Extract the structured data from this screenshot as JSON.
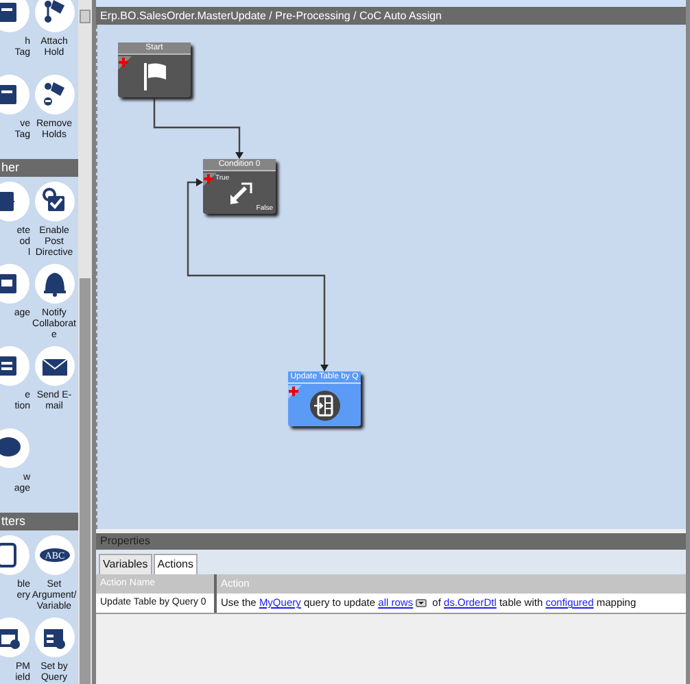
{
  "toolbox": {
    "sections": [
      {
        "items": [
          {
            "label": "h\nTag"
          },
          {
            "label": "Attach Hold"
          },
          {
            "label": "ve\nTag"
          },
          {
            "label": "Remove Holds"
          }
        ]
      },
      {
        "header": "her",
        "items": [
          {
            "label": "ete\nod\nl"
          },
          {
            "label": "Enable Post Directive"
          },
          {
            "label": "age"
          },
          {
            "label": "Notify\nCollaborat\ne"
          },
          {
            "label": "e\ntion"
          },
          {
            "label": "Send E-\nmail"
          },
          {
            "label": "w\nage"
          }
        ]
      },
      {
        "header": "tters",
        "icon_text": "ABC",
        "items": [
          {
            "label": "ble\nery"
          },
          {
            "label": "Set Argument/ Variable"
          },
          {
            "label": "PM\nield"
          },
          {
            "label": "Set by Query"
          }
        ]
      }
    ]
  },
  "workflow": {
    "title": "Erp.BO.SalesOrder.MasterUpdate / Pre-Processing / CoC Auto Assign",
    "nodes": [
      {
        "title": "Start",
        "kind": "start"
      },
      {
        "title": "Condition 0",
        "kind": "condition",
        "true_label": "True",
        "false_label": "False"
      },
      {
        "title": "Update Table by Q",
        "kind": "action"
      }
    ]
  },
  "properties": {
    "title": "Properties",
    "tabs": [
      {
        "label": "Variables",
        "selected": false
      },
      {
        "label": "Actions",
        "selected": true
      }
    ],
    "table": {
      "columns": [
        "Action Name",
        "Action"
      ],
      "rows": [
        {
          "name": "Update Table by Query 0",
          "action": [
            {
              "text": "Use the "
            },
            {
              "text": "MyQuery",
              "kind": "link"
            },
            {
              "text": " query to update "
            },
            {
              "text": "all rows",
              "kind": "link",
              "dropdown": true
            },
            {
              "text": " of "
            },
            {
              "text": "ds.OrderDtl",
              "kind": "link"
            },
            {
              "text": " table with "
            },
            {
              "text": "configured",
              "kind": "link"
            },
            {
              "text": " mapping"
            }
          ]
        }
      ]
    }
  }
}
